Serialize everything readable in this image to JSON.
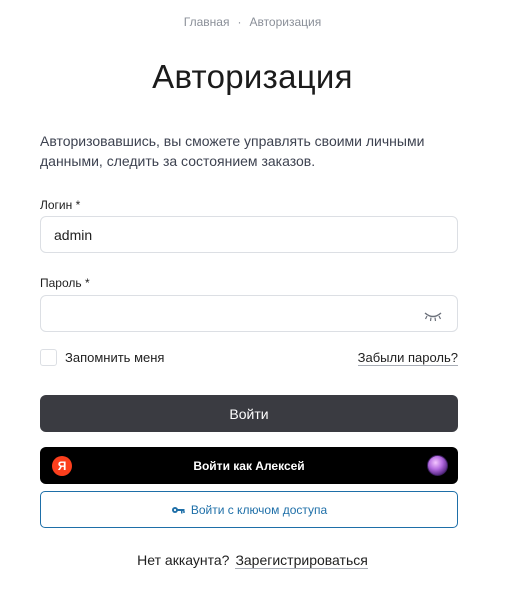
{
  "breadcrumb": {
    "home": "Главная",
    "separator": "·",
    "current": "Авторизация"
  },
  "page": {
    "title": "Авторизация",
    "intro": "Авторизовавшись, вы сможете управлять своими личными данными, следить за состоянием заказов."
  },
  "form": {
    "login_label": "Логин",
    "login_value": "admin",
    "password_label": "Пароль",
    "password_value": "",
    "required_mark": "*",
    "remember_label": "Запомнить меня",
    "forgot_link": "Забыли пароль?",
    "submit_label": "Войти",
    "eye_icon": "eye-closed-icon"
  },
  "yandex": {
    "logo_letter": "Я",
    "label": "Войти как Алексей",
    "logo_color": "#fc3f1d"
  },
  "access_key": {
    "label": "Войти с ключом доступа",
    "icon": "key-icon",
    "color": "#1e6fa8"
  },
  "footer": {
    "question": "Нет аккаунта?",
    "register_link": "Зарегистрироваться"
  },
  "colors": {
    "primary_button": "#3a3b41",
    "yandex_button": "#000000",
    "accent": "#1e6fa8"
  }
}
